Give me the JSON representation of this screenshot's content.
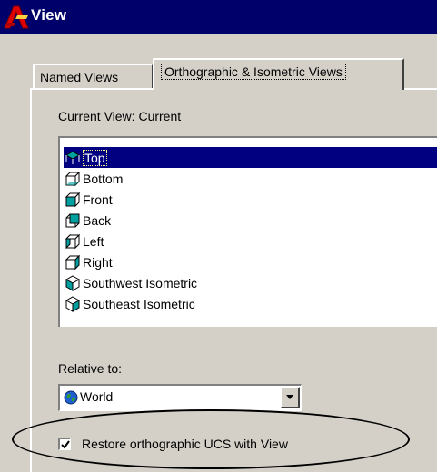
{
  "window": {
    "title": "View",
    "title_icon": "autocad-logo-icon",
    "colors": {
      "titlebar": "#00006b",
      "face": "#d4d0c8",
      "selection": "#000080"
    }
  },
  "tabs": [
    {
      "label": "Named Views",
      "active": false
    },
    {
      "label": "Orthographic & Isometric Views",
      "active": true
    }
  ],
  "current_view": {
    "label": "Current View:",
    "value": "Current"
  },
  "views": [
    {
      "label": "Top",
      "icon": "top-view-icon",
      "selected": true
    },
    {
      "label": "Bottom",
      "icon": "bottom-view-icon",
      "selected": false
    },
    {
      "label": "Front",
      "icon": "front-view-icon",
      "selected": false
    },
    {
      "label": "Back",
      "icon": "back-view-icon",
      "selected": false
    },
    {
      "label": "Left",
      "icon": "left-view-icon",
      "selected": false
    },
    {
      "label": "Right",
      "icon": "right-view-icon",
      "selected": false
    },
    {
      "label": "Southwest Isometric",
      "icon": "southwest-isometric-icon",
      "selected": false
    },
    {
      "label": "Southeast Isometric",
      "icon": "southeast-isometric-icon",
      "selected": false
    }
  ],
  "relative_to": {
    "label": "Relative to:",
    "value": "World",
    "icon": "globe-icon"
  },
  "restore_ucs": {
    "label": "Restore orthographic UCS with View",
    "checked": true
  }
}
